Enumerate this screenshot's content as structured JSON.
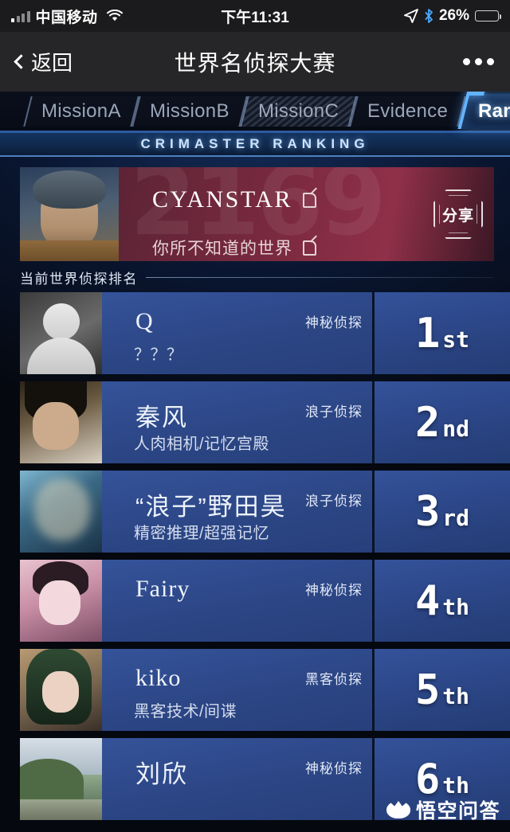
{
  "statusbar": {
    "carrier": "中国移动",
    "time": "下午11:31",
    "battery_pct": "26%",
    "signal_icon": "signal-bars-icon",
    "wifi_icon": "wifi-icon",
    "location_icon": "location-arrow-icon",
    "bluetooth_icon": "bluetooth-icon"
  },
  "navbar": {
    "back_label": "返回",
    "title": "世界名侦探大赛",
    "more_icon": "more-dots-icon"
  },
  "tabs": [
    {
      "label": "MissionA",
      "state": "normal"
    },
    {
      "label": "MissionB",
      "state": "normal"
    },
    {
      "label": "MissionC",
      "state": "locked"
    },
    {
      "label": "Evidence",
      "state": "normal"
    },
    {
      "label": "Ranking",
      "state": "active"
    }
  ],
  "banner": {
    "text": "CRIMASTER RANKING"
  },
  "profile": {
    "name": "CYANSTAR",
    "tagline": "你所不知道的世界",
    "watermark_number": "2169",
    "share_label": "分享",
    "edit_icon": "edit-pencil-icon",
    "avatar_icon": "user-avatar-image"
  },
  "section": {
    "title": "当前世界侦探排名"
  },
  "ranking": [
    {
      "name": "Q",
      "subtitle": "？？？",
      "type": "神秘侦探",
      "rank_num": "1",
      "rank_suffix": "st",
      "avatar_class": "av-q",
      "name_cjk": false
    },
    {
      "name": "秦风",
      "subtitle": "人肉相机/记忆宫殿",
      "type": "浪子侦探",
      "rank_num": "2",
      "rank_suffix": "nd",
      "avatar_class": "av-qinfeng",
      "name_cjk": true
    },
    {
      "name": "“浪子”野田昊",
      "subtitle": "精密推理/超强记忆",
      "type": "浪子侦探",
      "rank_num": "3",
      "rank_suffix": "rd",
      "avatar_class": "av-noda",
      "name_cjk": true
    },
    {
      "name": "Fairy",
      "subtitle": "",
      "type": "神秘侦探",
      "rank_num": "4",
      "rank_suffix": "th",
      "avatar_class": "av-fairy",
      "name_cjk": false
    },
    {
      "name": "kiko",
      "subtitle": "黑客技术/间谍",
      "type": "黑客侦探",
      "rank_num": "5",
      "rank_suffix": "th",
      "avatar_class": "av-kiko",
      "name_cjk": false
    },
    {
      "name": "刘欣",
      "subtitle": "",
      "type": "神秘侦探",
      "rank_num": "6",
      "rank_suffix": "th",
      "avatar_class": "av-liu",
      "name_cjk": true
    }
  ],
  "watermark": {
    "text": "悟空问答",
    "icon": "wukong-logo-icon"
  },
  "colors": {
    "accent_blue": "#63b4ff",
    "row_blue": "#2c4685",
    "profile_red": "#8f3048",
    "battery_yellow": "#f5c518"
  }
}
